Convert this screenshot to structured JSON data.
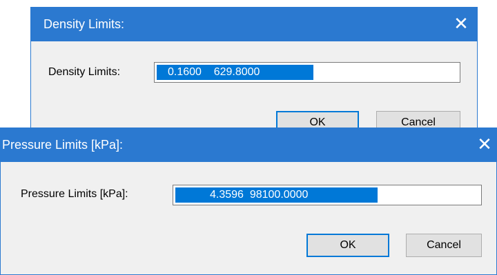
{
  "density_dialog": {
    "title": "Density Limits:",
    "field_label": "Density Limits:",
    "field_value": "0.1600    629.8000",
    "ok_label": "OK",
    "cancel_label": "Cancel"
  },
  "pressure_dialog": {
    "title": "Pressure Limits [kPa]:",
    "field_label": "Pressure Limits [kPa]:",
    "field_value": "4.3596  98100.0000",
    "ok_label": "OK",
    "cancel_label": "Cancel"
  },
  "icons": {
    "close": "close-icon"
  },
  "colors": {
    "titlebar": "#2b79d0",
    "selection": "#0078d7",
    "dialog_bg": "#f0f0f0",
    "button_bg": "#e1e1e1"
  }
}
